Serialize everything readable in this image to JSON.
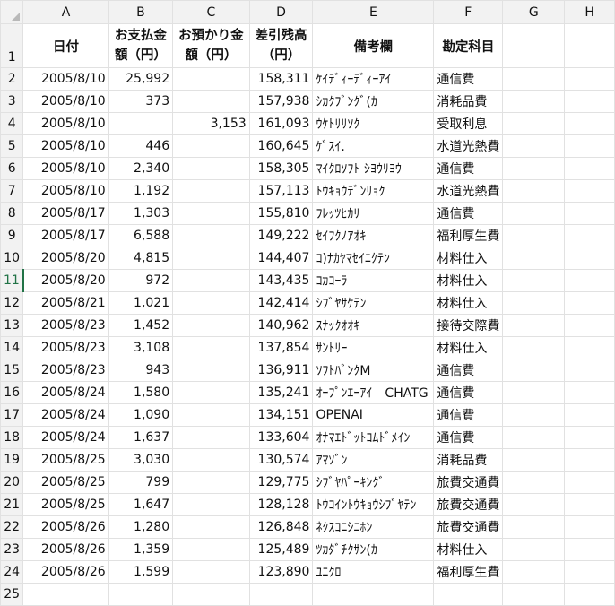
{
  "columns": [
    "A",
    "B",
    "C",
    "D",
    "E",
    "F",
    "G",
    "H"
  ],
  "header": {
    "row_number": "1",
    "date": "日付",
    "payment": "お支払金額（円）",
    "deposit": "お預かり金額（円）",
    "balance": "差引残高（円）",
    "memo": "備考欄",
    "account": "勘定科目"
  },
  "rows": [
    {
      "n": "2",
      "date": "2005/8/10",
      "payment": "25,992",
      "deposit": "",
      "balance": "158,311",
      "memo": "ｹｲﾃﾞｨｰﾃﾞｨｰｱｲ",
      "account": "通信費"
    },
    {
      "n": "3",
      "date": "2005/8/10",
      "payment": "373",
      "deposit": "",
      "balance": "157,938",
      "memo": "ｼｶｸﾌﾞﾝｸﾞ(ｶ",
      "account": "消耗品費"
    },
    {
      "n": "4",
      "date": "2005/8/10",
      "payment": "",
      "deposit": "3,153",
      "balance": "161,093",
      "memo": "ｳｹﾄﾘﾘｿｸ",
      "account": "受取利息"
    },
    {
      "n": "5",
      "date": "2005/8/10",
      "payment": "446",
      "deposit": "",
      "balance": "160,645",
      "memo": "ｹﾞｽｲ.",
      "account": "水道光熱費"
    },
    {
      "n": "6",
      "date": "2005/8/10",
      "payment": "2,340",
      "deposit": "",
      "balance": "158,305",
      "memo": "ﾏｲｸﾛｿﾌﾄ ｼﾖｳﾘﾖｳ",
      "account": "通信費"
    },
    {
      "n": "7",
      "date": "2005/8/10",
      "payment": "1,192",
      "deposit": "",
      "balance": "157,113",
      "memo": "ﾄｳｷｮｳﾃﾞﾝﾘｮｸ",
      "account": "水道光熱費"
    },
    {
      "n": "8",
      "date": "2005/8/17",
      "payment": "1,303",
      "deposit": "",
      "balance": "155,810",
      "memo": "ﾌﾚｯﾂﾋｶﾘ",
      "account": "通信費"
    },
    {
      "n": "9",
      "date": "2005/8/17",
      "payment": "6,588",
      "deposit": "",
      "balance": "149,222",
      "memo": "ｾｲﾌｸﾉｱｵｷ",
      "account": "福利厚生費"
    },
    {
      "n": "10",
      "date": "2005/8/20",
      "payment": "4,815",
      "deposit": "",
      "balance": "144,407",
      "memo": "ｺ)ﾅｶﾔﾏｾｲﾆｸﾃﾝ",
      "account": "材料仕入"
    },
    {
      "n": "11",
      "date": "2005/8/20",
      "payment": "972",
      "deposit": "",
      "balance": "143,435",
      "memo": "ｺｶｺｰﾗ",
      "account": "材料仕入"
    },
    {
      "n": "12",
      "date": "2005/8/21",
      "payment": "1,021",
      "deposit": "",
      "balance": "142,414",
      "memo": "ｼﾌﾞﾔｻｹﾃﾝ",
      "account": "材料仕入"
    },
    {
      "n": "13",
      "date": "2005/8/23",
      "payment": "1,452",
      "deposit": "",
      "balance": "140,962",
      "memo": "ｽﾅｯｸｵｵｷ",
      "account": "接待交際費"
    },
    {
      "n": "14",
      "date": "2005/8/23",
      "payment": "3,108",
      "deposit": "",
      "balance": "137,854",
      "memo": "ｻﾝﾄﾘｰ",
      "account": "材料仕入"
    },
    {
      "n": "15",
      "date": "2005/8/23",
      "payment": "943",
      "deposit": "",
      "balance": "136,911",
      "memo": "ｿﾌﾄﾊﾞﾝｸM",
      "account": "通信費"
    },
    {
      "n": "16",
      "date": "2005/8/24",
      "payment": "1,580",
      "deposit": "",
      "balance": "135,241",
      "memo": "ｵｰﾌﾟﾝｴｰｱｲ　CHATG",
      "account": "通信費"
    },
    {
      "n": "17",
      "date": "2005/8/24",
      "payment": "1,090",
      "deposit": "",
      "balance": "134,151",
      "memo": "OPENAI",
      "account": "通信費"
    },
    {
      "n": "18",
      "date": "2005/8/24",
      "payment": "1,637",
      "deposit": "",
      "balance": "133,604",
      "memo": "ｵﾅﾏｴﾄﾞｯﾄｺﾑﾄﾞﾒｲﾝ",
      "account": "通信費"
    },
    {
      "n": "19",
      "date": "2005/8/25",
      "payment": "3,030",
      "deposit": "",
      "balance": "130,574",
      "memo": "ｱﾏｿﾞﾝ",
      "account": "消耗品費"
    },
    {
      "n": "20",
      "date": "2005/8/25",
      "payment": "799",
      "deposit": "",
      "balance": "129,775",
      "memo": "ｼﾌﾞﾔﾊﾟｰｷﾝｸﾞ",
      "account": "旅費交通費"
    },
    {
      "n": "21",
      "date": "2005/8/25",
      "payment": "1,647",
      "deposit": "",
      "balance": "128,128",
      "memo": "ﾄｳｺｲﾝﾄｳｷｮｳｼﾌﾞﾔﾃﾝ",
      "account": "旅費交通費"
    },
    {
      "n": "22",
      "date": "2005/8/26",
      "payment": "1,280",
      "deposit": "",
      "balance": "126,848",
      "memo": "ﾈｸｽｺﾆｼﾆﾎﾝ",
      "account": "旅費交通費"
    },
    {
      "n": "23",
      "date": "2005/8/26",
      "payment": "1,359",
      "deposit": "",
      "balance": "125,489",
      "memo": "ﾂｶﾀﾞﾁｸｻﾝ(ｶ",
      "account": "材料仕入"
    },
    {
      "n": "24",
      "date": "2005/8/26",
      "payment": "1,599",
      "deposit": "",
      "balance": "123,890",
      "memo": "ﾕﾆｸﾛ",
      "account": "福利厚生費"
    }
  ],
  "empty_row": "25",
  "selected_row": "11"
}
